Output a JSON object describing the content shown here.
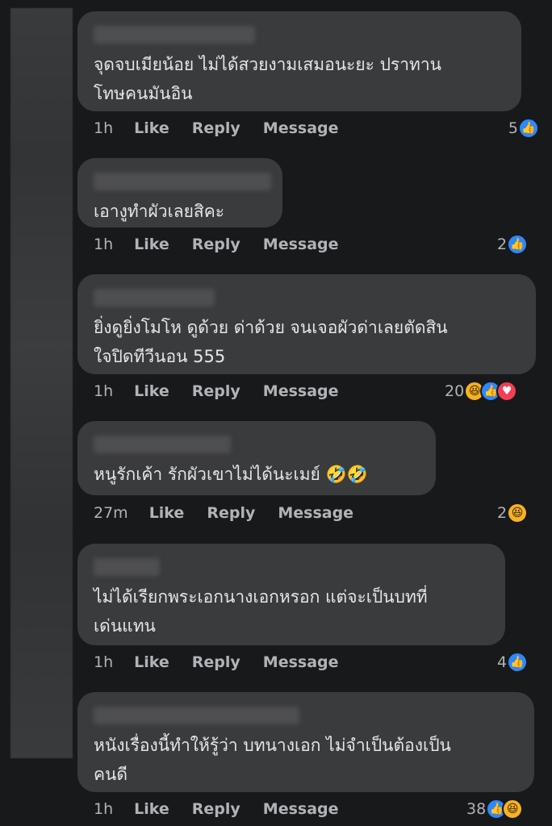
{
  "comments": [
    {
      "text": "จุดจบเมียน้อย ไม่ได้สวยงามเสมอนะยะ ปราทาน\nโทษคนมันอิน",
      "time": "1h",
      "like": "Like",
      "reply": "Reply",
      "message": "Message",
      "count": "5",
      "reactions": [
        "like"
      ]
    },
    {
      "text": "เอางูทำผัวเลยสิคะ",
      "time": "1h",
      "like": "Like",
      "reply": "Reply",
      "message": "Message",
      "count": "2",
      "reactions": [
        "like"
      ]
    },
    {
      "text": "ยิ่งดูยิ่งโมโห ดูด้วย ด่าด้วย จนเจอผัวด่าเลยตัดสิน\nใจปิดทีวีนอน 555",
      "time": "1h",
      "like": "Like",
      "reply": "Reply",
      "message": "Message",
      "count": "20",
      "reactions": [
        "haha",
        "like",
        "love"
      ]
    },
    {
      "text": "หนูรักเค้า รักผัวเขาไม่ได้นะเมย์ 🤣🤣",
      "time": "27m",
      "like": "Like",
      "reply": "Reply",
      "message": "Message",
      "count": "2",
      "reactions": [
        "haha"
      ]
    },
    {
      "text": "ไม่ได้เรียกพระเอกนางเอกหรอก แต่จะเป็นบทที่\nเด่นแทน",
      "time": "1h",
      "like": "Like",
      "reply": "Reply",
      "message": "Message",
      "count": "4",
      "reactions": [
        "like"
      ]
    },
    {
      "text": "หนังเรื่องนี้ทำให้รู้ว่า บทนางเอก ไม่จำเป็นต้องเป็น\nคนดี",
      "time": "1h",
      "like": "Like",
      "reply": "Reply",
      "message": "Message",
      "count": "38",
      "reactions": [
        "like",
        "haha"
      ]
    }
  ],
  "icons": {
    "like": "like-icon",
    "love": "love-icon",
    "haha": "haha-icon"
  },
  "colors": {
    "background": "#18191a",
    "bubble": "#3a3b3c",
    "like": "#2d88ff",
    "love": "#f33e58",
    "haha": "#f7b125"
  }
}
